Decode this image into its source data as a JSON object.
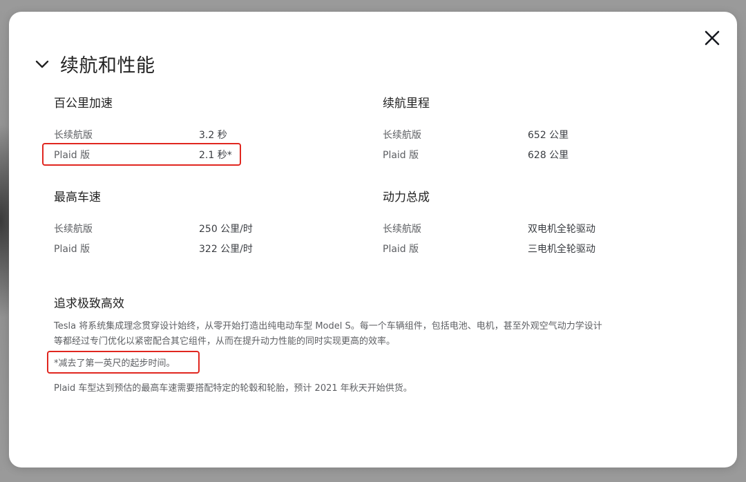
{
  "section": {
    "title": "续航和性能"
  },
  "specs": {
    "acceleration": {
      "title": "百公里加速",
      "rows": [
        {
          "label": "长续航版",
          "value": "3.2 秒"
        },
        {
          "label": "Plaid 版",
          "value": "2.1 秒*"
        }
      ]
    },
    "range": {
      "title": "续航里程",
      "rows": [
        {
          "label": "长续航版",
          "value": "652 公里"
        },
        {
          "label": "Plaid 版",
          "value": "628 公里"
        }
      ]
    },
    "top_speed": {
      "title": "最高车速",
      "rows": [
        {
          "label": "长续航版",
          "value": "250 公里/时"
        },
        {
          "label": "Plaid 版",
          "value": "322 公里/时"
        }
      ]
    },
    "powertrain": {
      "title": "动力总成",
      "rows": [
        {
          "label": "长续航版",
          "value": "双电机全轮驱动"
        },
        {
          "label": "Plaid 版",
          "value": "三电机全轮驱动"
        }
      ]
    }
  },
  "efficiency": {
    "title": "追求极致高效",
    "text": "Tesla 将系统集成理念贯穿设计始终，从零开始打造出纯电动车型 Model S。每一个车辆组件，包括电池、电机，甚至外观空气动力学设计等都经过专门优化以紧密配合其它组件，从而在提升动力性能的同时实现更高的效率。"
  },
  "footnotes": {
    "acceleration_note": "*减去了第一英尺的起步时间。",
    "plaid_note": "Plaid 车型达到预估的最高车速需要搭配特定的轮毂和轮胎，预计 2021 年秋天开始供货。"
  },
  "icons": {
    "close": "close-icon",
    "chevron": "chevron-down-icon"
  },
  "colors": {
    "highlight": "#e0261f"
  }
}
